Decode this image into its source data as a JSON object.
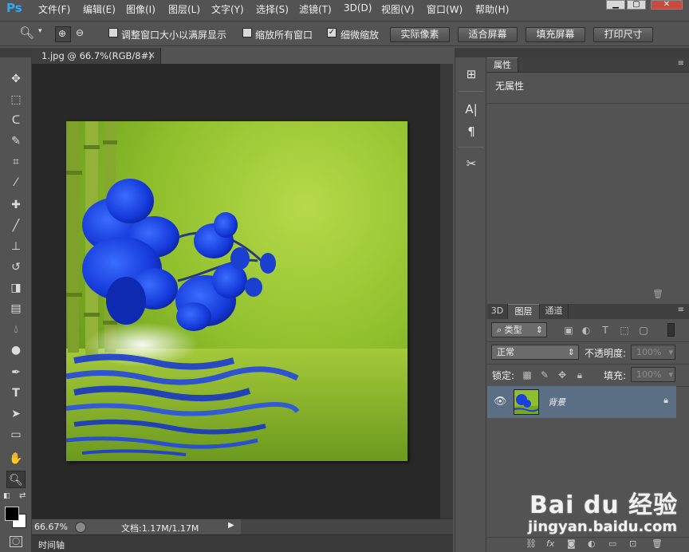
{
  "app": {
    "logo": "Ps"
  },
  "menu": [
    "文件(F)",
    "编辑(E)",
    "图像(I)",
    "图层(L)",
    "文字(Y)",
    "选择(S)",
    "滤镜(T)",
    "3D(D)",
    "视图(V)",
    "窗口(W)",
    "帮助(H)"
  ],
  "window_controls": {
    "minimize": "▁",
    "restore": "▢",
    "close": "✕"
  },
  "options": {
    "resize_windows_label": "调整窗口大小以满屏显示",
    "resize_windows_checked": false,
    "zoom_all_label": "缩放所有窗口",
    "zoom_all_checked": false,
    "scrubby_zoom_label": "细微缩放",
    "scrubby_zoom_checked": true,
    "actual_pixels": "实际像素",
    "fit_screen": "适合屏幕",
    "fill_screen": "填充屏幕",
    "print_size": "打印尺寸"
  },
  "document": {
    "tab_title": "1.jpg @ 66.7%(RGB/8#)",
    "close": "×"
  },
  "status": {
    "zoom": "66.67%",
    "doc_size": "文档:1.17M/1.17M"
  },
  "timeline": {
    "label": "时间轴"
  },
  "properties": {
    "tab": "属性",
    "title": "无属性"
  },
  "layers": {
    "tabs": [
      "3D",
      "图层",
      "通道"
    ],
    "active_tab": "图层",
    "filter_kind": "类型",
    "blend_mode": "正常",
    "opacity_label": "不透明度:",
    "opacity_value": "100%",
    "lock_label": "锁定:",
    "fill_label": "填充:",
    "fill_value": "100%",
    "items": [
      {
        "name": "背景",
        "visible": true,
        "locked": true
      }
    ]
  },
  "watermark": {
    "brand": "Bai du 经验",
    "url": "jingyan.baidu.com"
  }
}
